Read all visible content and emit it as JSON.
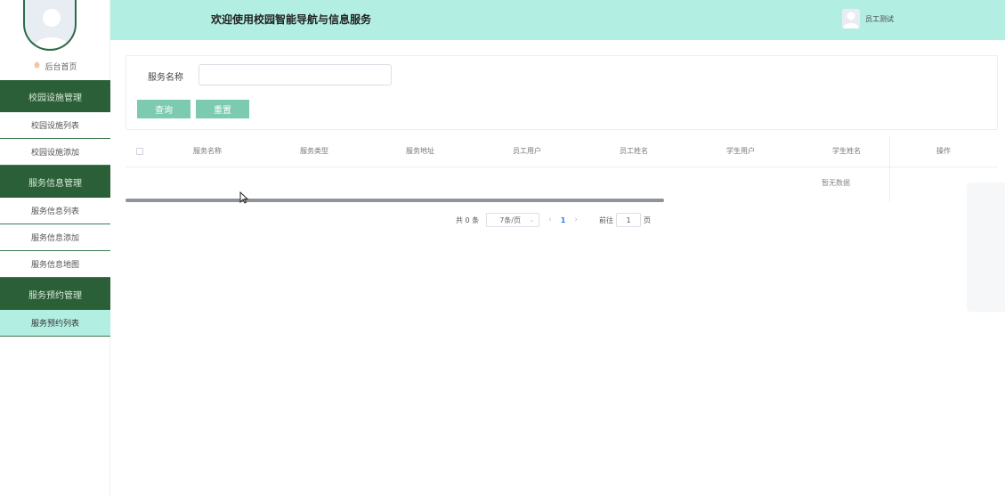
{
  "header": {
    "title": "欢迎使用校园智能导航与信息服务",
    "user_name": "员工测试"
  },
  "sidebar": {
    "home_label": "后台首页",
    "groups": [
      {
        "label": "校园设施管理",
        "items": [
          {
            "label": "校园设施列表"
          },
          {
            "label": "校园设施添加"
          }
        ]
      },
      {
        "label": "服务信息管理",
        "items": [
          {
            "label": "服务信息列表"
          },
          {
            "label": "服务信息添加"
          },
          {
            "label": "服务信息地图"
          }
        ]
      },
      {
        "label": "服务预约管理",
        "items": [
          {
            "label": "服务预约列表",
            "active": true
          }
        ]
      }
    ]
  },
  "search": {
    "label": "服务名称",
    "value": "",
    "query_label": "查询",
    "reset_label": "重置"
  },
  "table": {
    "columns": [
      "服务名称",
      "服务类型",
      "服务地址",
      "员工用户",
      "员工姓名",
      "学生用户",
      "学生姓名",
      "操作"
    ],
    "empty_text": "暂无数据"
  },
  "pagination": {
    "total": "共 0 条",
    "page_size": "7条/页",
    "current_page": "1",
    "goto_label": "前往",
    "goto_value": "1",
    "page_suffix": "页"
  },
  "colors": {
    "header_bg": "#b2efe2",
    "sidebar_group_bg": "#2b5f37",
    "active_item_bg": "#b2eee2",
    "button_bg": "#7ccab0"
  }
}
